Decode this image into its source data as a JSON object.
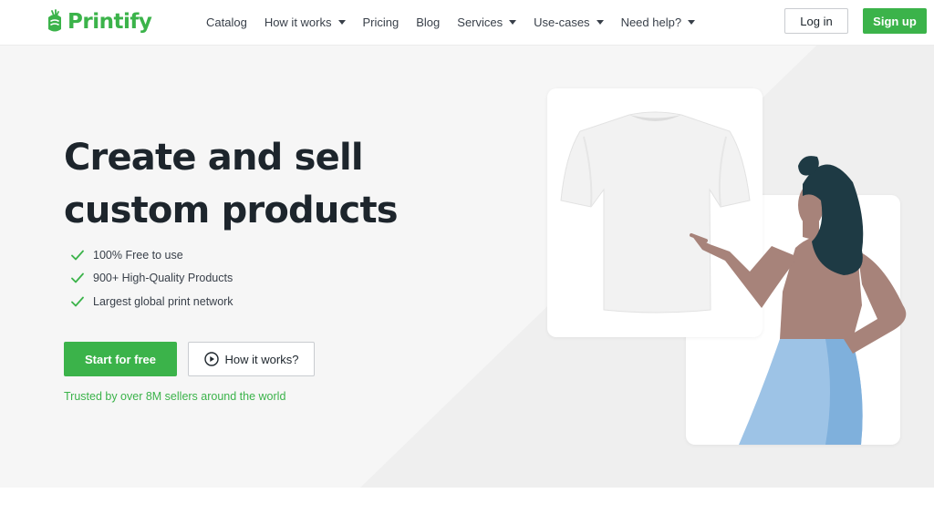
{
  "brand": {
    "name": "Printify",
    "color": "#3bb34a"
  },
  "nav": {
    "items": [
      {
        "label": "Catalog",
        "dropdown": false
      },
      {
        "label": "How it works",
        "dropdown": true
      },
      {
        "label": "Pricing",
        "dropdown": false
      },
      {
        "label": "Blog",
        "dropdown": false
      },
      {
        "label": "Services",
        "dropdown": true
      },
      {
        "label": "Use-cases",
        "dropdown": true
      },
      {
        "label": "Need help?",
        "dropdown": true
      }
    ],
    "login_label": "Log in",
    "signup_label": "Sign up"
  },
  "hero": {
    "headline_line1": "Create and sell",
    "headline_line2": "custom products",
    "features": [
      "100% Free to use",
      "900+ High-Quality Products",
      "Largest global print network"
    ],
    "start_label": "Start for free",
    "how_label": "How it works?",
    "trusted_text": "Trusted by over 8M sellers around the world"
  },
  "icons": {
    "logo": "printify-logo-icon",
    "check": "check-icon",
    "play": "play-circle-icon",
    "caret": "chevron-down-icon"
  },
  "colors": {
    "accent": "#3bb34a",
    "text": "#1d252c",
    "hero_bg": "#f6f6f6"
  }
}
